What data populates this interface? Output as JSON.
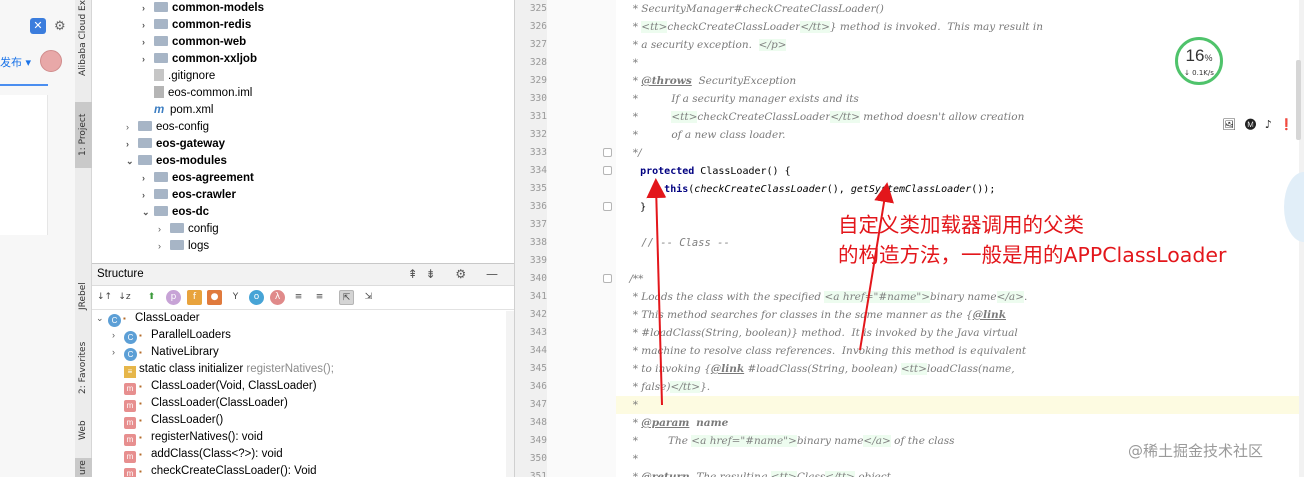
{
  "left_window": {
    "publish_label": "发布 ▾"
  },
  "tool_tabs": {
    "alibaba": "Alibaba Cloud Expl",
    "project": "1: Project",
    "jrebel": "JRebel",
    "favorites": "2: Favorites",
    "web": "Web",
    "structure": "ure"
  },
  "project_tree": [
    {
      "label": "common-models",
      "bold": true,
      "indent": 2,
      "arrow": "›",
      "icon": "folder"
    },
    {
      "label": "common-redis",
      "bold": true,
      "indent": 2,
      "arrow": "›",
      "icon": "folder"
    },
    {
      "label": "common-web",
      "bold": true,
      "indent": 2,
      "arrow": "›",
      "icon": "folder"
    },
    {
      "label": "common-xxljob",
      "bold": true,
      "indent": 2,
      "arrow": "›",
      "icon": "folder"
    },
    {
      "label": ".gitignore",
      "bold": false,
      "indent": 2,
      "arrow": "",
      "icon": "git"
    },
    {
      "label": "eos-common.iml",
      "bold": false,
      "indent": 2,
      "arrow": "",
      "icon": "iml"
    },
    {
      "label": "pom.xml",
      "bold": false,
      "indent": 2,
      "arrow": "",
      "icon": "m"
    },
    {
      "label": "eos-config",
      "bold": false,
      "indent": 1,
      "arrow": "›",
      "icon": "folder"
    },
    {
      "label": "eos-gateway",
      "bold": true,
      "indent": 1,
      "arrow": "›",
      "icon": "folder"
    },
    {
      "label": "eos-modules",
      "bold": true,
      "indent": 1,
      "arrow": "⌄",
      "icon": "folder"
    },
    {
      "label": "eos-agreement",
      "bold": true,
      "indent": 2,
      "arrow": "›",
      "icon": "folder"
    },
    {
      "label": "eos-crawler",
      "bold": true,
      "indent": 2,
      "arrow": "›",
      "icon": "folder"
    },
    {
      "label": "eos-dc",
      "bold": true,
      "indent": 2,
      "arrow": "⌄",
      "icon": "folder"
    },
    {
      "label": "config",
      "bold": false,
      "indent": 3,
      "arrow": "›",
      "icon": "folder"
    },
    {
      "label": "logs",
      "bold": false,
      "indent": 3,
      "arrow": "›",
      "icon": "folder"
    }
  ],
  "structure": {
    "title": "Structure",
    "rows": [
      {
        "label": "ClassLoader",
        "extra": "",
        "indent": 0,
        "arrow": "⌄",
        "icon": "c"
      },
      {
        "label": "ParallelLoaders",
        "extra": "",
        "indent": 1,
        "arrow": "›",
        "icon": "c"
      },
      {
        "label": "NativeLibrary",
        "extra": "",
        "indent": 1,
        "arrow": "›",
        "icon": "c"
      },
      {
        "label": "static class initializer",
        "extra": " registerNatives();",
        "indent": 1,
        "arrow": "",
        "icon": "s"
      },
      {
        "label": "ClassLoader(Void, ClassLoader)",
        "extra": "",
        "indent": 1,
        "arrow": "",
        "icon": "m"
      },
      {
        "label": "ClassLoader(ClassLoader)",
        "extra": "",
        "indent": 1,
        "arrow": "",
        "icon": "m"
      },
      {
        "label": "ClassLoader()",
        "extra": "",
        "indent": 1,
        "arrow": "",
        "icon": "m"
      },
      {
        "label": "registerNatives(): void",
        "extra": "",
        "indent": 1,
        "arrow": "",
        "icon": "m"
      },
      {
        "label": "addClass(Class<?>): void",
        "extra": "",
        "indent": 1,
        "arrow": "",
        "icon": "m"
      },
      {
        "label": "checkCreateClassLoader(): Void",
        "extra": "",
        "indent": 1,
        "arrow": "",
        "icon": "m"
      }
    ]
  },
  "line_numbers": [
    "325",
    "326",
    "327",
    "328",
    "329",
    "330",
    "331",
    "332",
    "333",
    "334",
    "335",
    "336",
    "337",
    "338",
    "339",
    "340",
    "341",
    "342",
    "343",
    "344",
    "345",
    "346",
    "347",
    "348",
    "349",
    "350",
    "351"
  ],
  "speed_widget": {
    "percent": "16",
    "unit": "%",
    "rate": "↓ 0.1K/s"
  },
  "annotation": {
    "line1": "自定义类加载器调用的父类",
    "line2": "的构造方法，一般是用的APPClassLoader"
  },
  "watermark": "@稀土掘金技术社区",
  "colors": {
    "annotation": "#e3161b",
    "keyword": "#000080",
    "doc_comment": "#7a7a7a",
    "current_line": "#fdfbe1"
  }
}
